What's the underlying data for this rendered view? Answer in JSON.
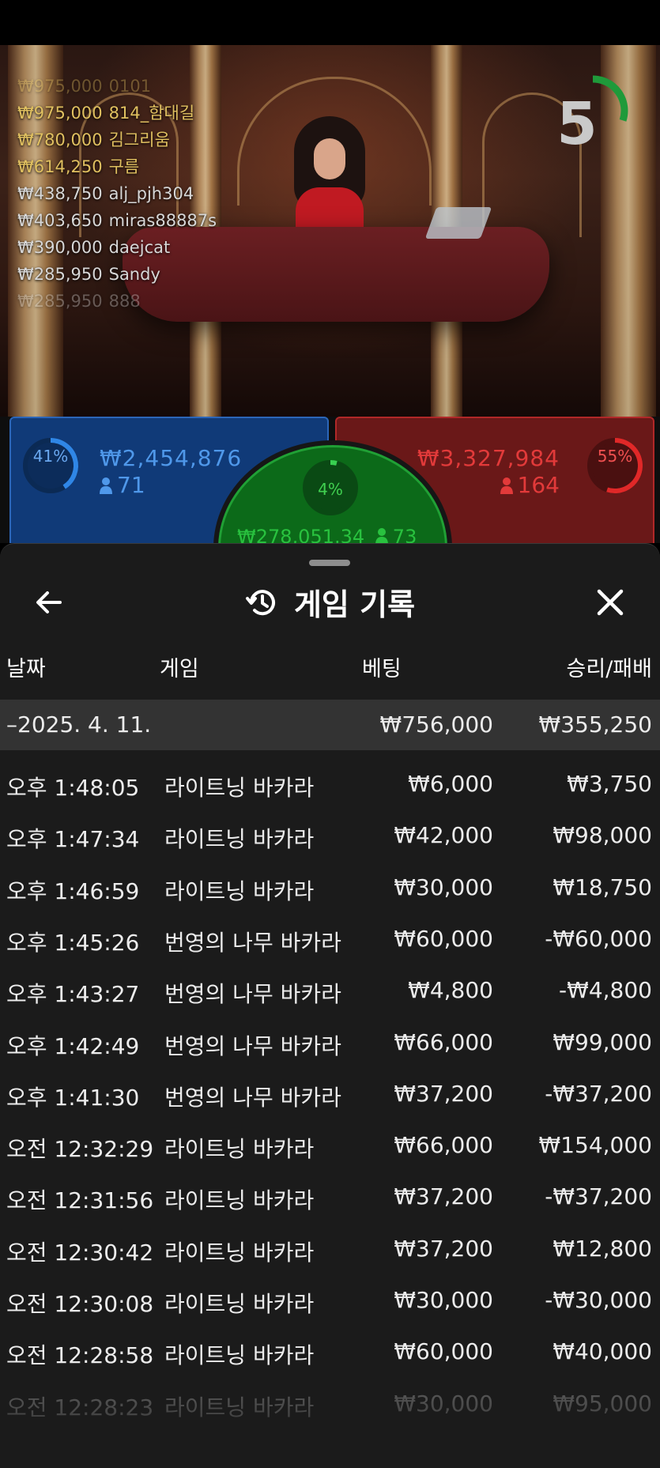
{
  "leaderboard": [
    {
      "amount": "₩975,000",
      "name": "0101",
      "style": "gold fade"
    },
    {
      "amount": "₩975,000",
      "name": "814_함대길",
      "style": "gold"
    },
    {
      "amount": "₩780,000",
      "name": "김그리움",
      "style": "gold"
    },
    {
      "amount": "₩614,250",
      "name": "구름",
      "style": "gold"
    },
    {
      "amount": "₩438,750",
      "name": "alj_pjh304",
      "style": "gray"
    },
    {
      "amount": "₩403,650",
      "name": "miras88887s",
      "style": "gray"
    },
    {
      "amount": "₩390,000",
      "name": "daejcat",
      "style": "gray"
    },
    {
      "amount": "₩285,950",
      "name": "Sandy",
      "style": "gray"
    },
    {
      "amount": "₩285,950",
      "name": "888",
      "style": "gray fade"
    }
  ],
  "timer": {
    "value": "5"
  },
  "betting": {
    "player": {
      "percent": "41%",
      "amount": "₩2,454,876",
      "players": "71",
      "fill": 0.41
    },
    "banker": {
      "percent": "55%",
      "amount": "₩3,327,984",
      "players": "164",
      "fill": 0.55
    },
    "tie": {
      "percent": "4%",
      "amount": "₩278,051.34",
      "players": "73",
      "fill": 0.04
    }
  },
  "sheet": {
    "title": "게임 기록",
    "columns": {
      "date": "날짜",
      "game": "게임",
      "bet": "베팅",
      "result": "승리/패배"
    },
    "summary": {
      "date": "–2025. 4. 11.",
      "bet": "₩756,000",
      "result": "₩355,250"
    },
    "rows": [
      {
        "time": "오후 1:48:05",
        "game": "라이트닝 바카라",
        "bet": "₩6,000",
        "result": "₩3,750"
      },
      {
        "time": "오후 1:47:34",
        "game": "라이트닝 바카라",
        "bet": "₩42,000",
        "result": "₩98,000"
      },
      {
        "time": "오후 1:46:59",
        "game": "라이트닝 바카라",
        "bet": "₩30,000",
        "result": "₩18,750"
      },
      {
        "time": "오후 1:45:26",
        "game": "번영의 나무 바카라",
        "bet": "₩60,000",
        "result": "-₩60,000"
      },
      {
        "time": "오후 1:43:27",
        "game": "번영의 나무 바카라",
        "bet": "₩4,800",
        "result": "-₩4,800"
      },
      {
        "time": "오후 1:42:49",
        "game": "번영의 나무 바카라",
        "bet": "₩66,000",
        "result": "₩99,000"
      },
      {
        "time": "오후 1:41:30",
        "game": "번영의 나무 바카라",
        "bet": "₩37,200",
        "result": "-₩37,200"
      },
      {
        "time": "오전 12:32:29",
        "game": "라이트닝 바카라",
        "bet": "₩66,000",
        "result": "₩154,000"
      },
      {
        "time": "오전 12:31:56",
        "game": "라이트닝 바카라",
        "bet": "₩37,200",
        "result": "-₩37,200"
      },
      {
        "time": "오전 12:30:42",
        "game": "라이트닝 바카라",
        "bet": "₩37,200",
        "result": "₩12,800"
      },
      {
        "time": "오전 12:30:08",
        "game": "라이트닝 바카라",
        "bet": "₩30,000",
        "result": "-₩30,000"
      },
      {
        "time": "오전 12:28:58",
        "game": "라이트닝 바카라",
        "bet": "₩60,000",
        "result": "₩40,000"
      },
      {
        "time": "오전 12:28:23",
        "game": "라이트닝 바카라",
        "bet": "₩30,000",
        "result": "₩95,000"
      }
    ]
  },
  "colors": {
    "player": "#4f98ea",
    "banker": "#e23a3a",
    "tie": "#29c23f",
    "leader_gold": "#e0c060",
    "timer_ring": "#1f9a3a"
  },
  "icons": {
    "back": "arrow-left-icon",
    "history": "history-icon",
    "close": "close-icon",
    "user": "user-icon"
  }
}
